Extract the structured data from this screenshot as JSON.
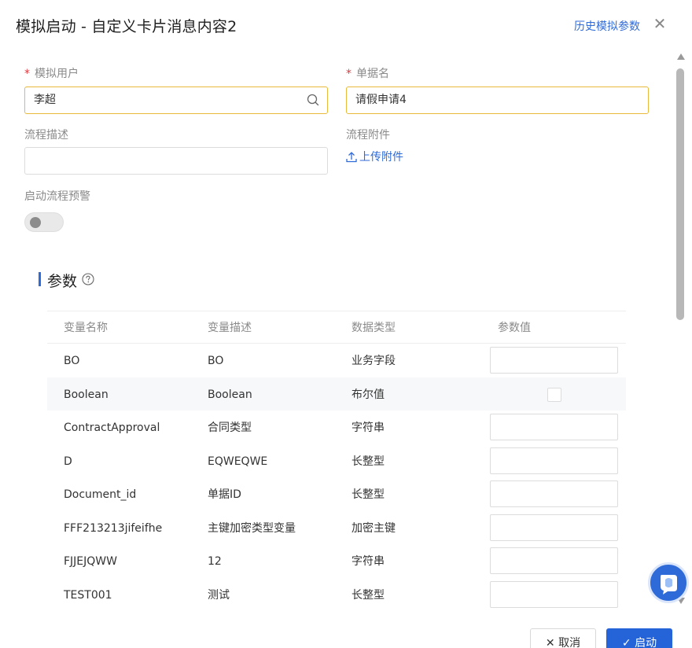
{
  "dialog": {
    "title": "模拟启动 - 自定义卡片消息内容2",
    "history_link": "历史模拟参数",
    "close_symbol": "✕"
  },
  "form": {
    "user": {
      "required_mark": "*",
      "label": "模拟用户",
      "value": "李超"
    },
    "doc_name": {
      "required_mark": "*",
      "label": "单据名",
      "value": "请假申请4"
    },
    "desc": {
      "label": "流程描述",
      "value": ""
    },
    "attachment": {
      "label": "流程附件",
      "upload_label": "上传附件"
    },
    "warning": {
      "label": "启动流程预警",
      "enabled": false
    }
  },
  "params": {
    "title": "参数",
    "columns": [
      "变量名称",
      "变量描述",
      "数据类型",
      "参数值"
    ],
    "rows": [
      {
        "name": "BO",
        "desc": "BO",
        "type": "业务字段",
        "input": "text"
      },
      {
        "name": "Boolean",
        "desc": "Boolean",
        "type": "布尔值",
        "input": "checkbox"
      },
      {
        "name": "ContractApproval",
        "desc": "合同类型",
        "type": "字符串",
        "input": "text"
      },
      {
        "name": "D",
        "desc": "EQWEQWE",
        "type": "长整型",
        "input": "text"
      },
      {
        "name": "Document_id",
        "desc": "单据ID",
        "type": "长整型",
        "input": "text"
      },
      {
        "name": "FFF213213jifeifhe",
        "desc": "主键加密类型变量",
        "type": "加密主键",
        "input": "text"
      },
      {
        "name": "FJJEJQWW",
        "desc": "12",
        "type": "字符串",
        "input": "text"
      },
      {
        "name": "TEST001",
        "desc": "测试",
        "type": "长整型",
        "input": "text"
      }
    ]
  },
  "footer": {
    "cancel_label": "取消",
    "cancel_icon": "✕",
    "start_label": "启动",
    "start_icon": "✓"
  },
  "colors": {
    "accent": "#2f6bd8",
    "focus_border": "#e8b93a",
    "required": "#e0393e"
  },
  "icons": [
    "search-icon",
    "upload-icon",
    "help-icon",
    "close-icon",
    "assistant-icon",
    "check-icon"
  ]
}
